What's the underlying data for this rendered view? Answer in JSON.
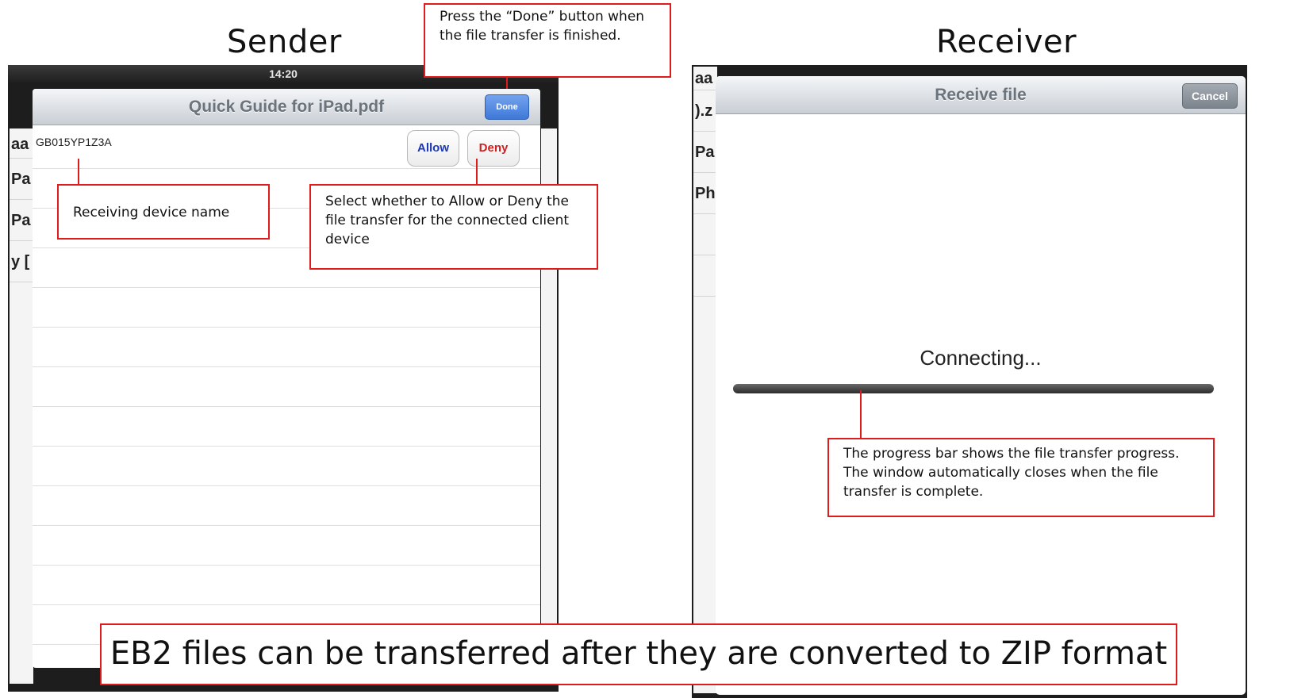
{
  "headings": {
    "sender": "Sender",
    "receiver": "Receiver"
  },
  "sender": {
    "status_time": "14:20",
    "title": "Quick Guide for iPad.pdf",
    "done_label": "Done",
    "device_name": "GB015YP1Z3A",
    "allow_label": "Allow",
    "deny_label": "Deny",
    "background_rows": [
      "aa",
      "Pa",
      "Pa",
      "y ["
    ]
  },
  "receiver": {
    "title": "Receive file",
    "cancel_label": "Cancel",
    "status_text": "Connecting...",
    "progress_percent": 0,
    "background_rows": [
      "aa",
      ").z",
      "Pa",
      "Ph"
    ]
  },
  "callouts": {
    "done_note": "Press the “Done” button when the file transfer is finished.",
    "device_note": "Receiving device name",
    "allow_note": "Select whether to Allow or Deny the file transfer for the connected client device",
    "progress_note": "The progress bar shows the file transfer progress. The window automatically closes when the file transfer is complete.",
    "eb2_note": "EB2 files can be transferred after they are converted to ZIP format"
  },
  "colors": {
    "callout_border": "#e01b1b",
    "done_button": "#3e79d8",
    "allow_text": "#1e39b6",
    "deny_text": "#d11f1f"
  }
}
